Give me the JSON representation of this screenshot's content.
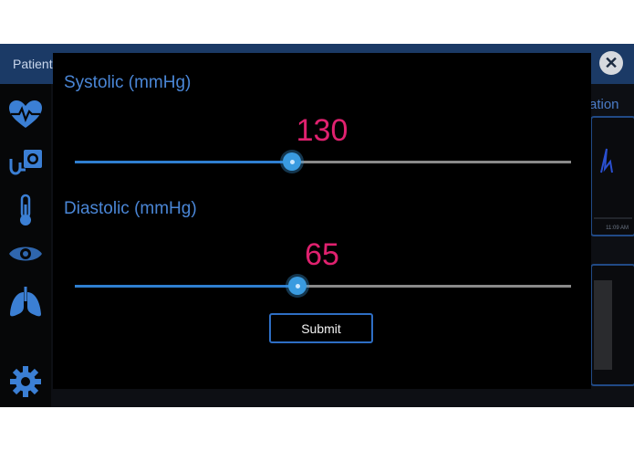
{
  "header": {
    "title": "Patient",
    "close_icon": "close-icon"
  },
  "sidebar": {
    "items": [
      {
        "icon": "heart-rate-icon"
      },
      {
        "icon": "stethoscope-icon"
      },
      {
        "icon": "thermometer-icon"
      },
      {
        "icon": "eye-icon"
      },
      {
        "icon": "lungs-icon"
      },
      {
        "icon": "settings-gear-icon"
      }
    ]
  },
  "background": {
    "right_label": "ation",
    "card_time": "11:09 AM"
  },
  "dialog": {
    "systolic": {
      "label": "Systolic (mmHg)",
      "value": "130",
      "slider_position_fraction": 0.44
    },
    "diastolic": {
      "label": "Diastolic (mmHg)",
      "value": "65",
      "slider_position_fraction": 0.45
    },
    "submit_label": "Submit"
  },
  "colors": {
    "accent_blue": "#4a86d6",
    "value_pink": "#e0216f",
    "header_bg": "#1b3a66"
  }
}
